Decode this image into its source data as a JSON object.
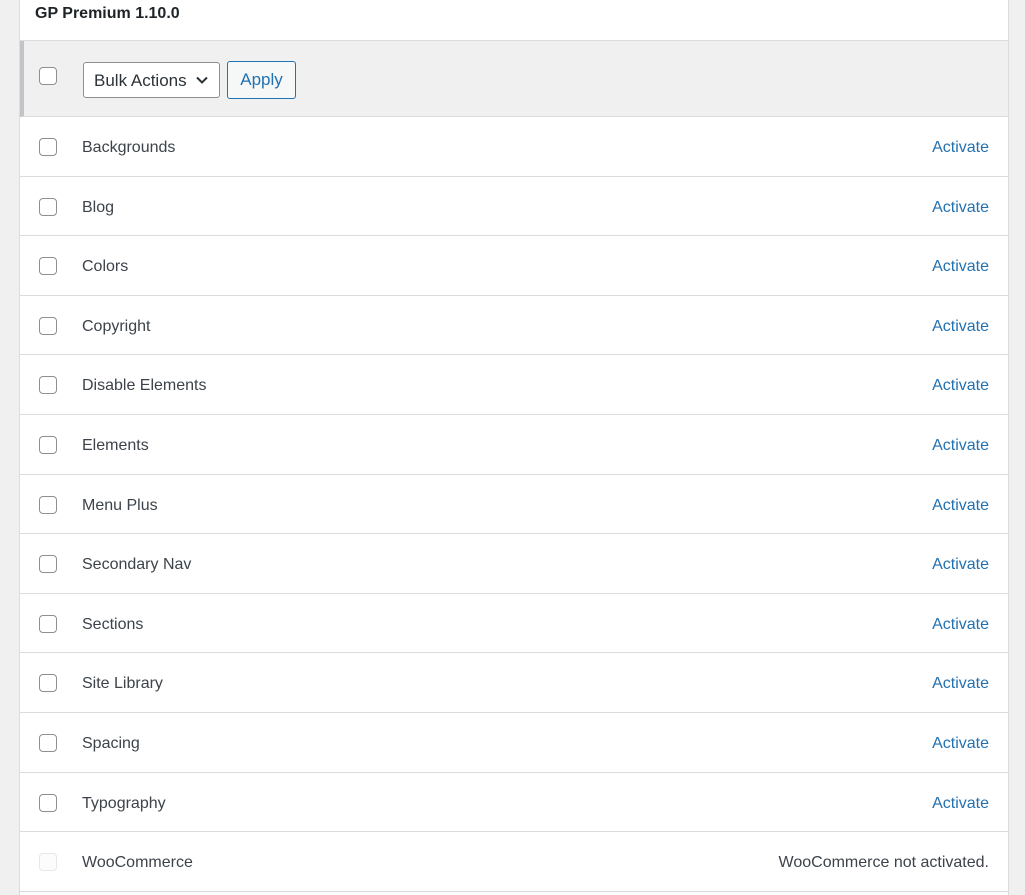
{
  "header": {
    "title": "GP Premium 1.10.0"
  },
  "bulk": {
    "select_label": "Bulk Actions",
    "apply_label": "Apply"
  },
  "modules": [
    {
      "name": "Backgrounds",
      "action": "Activate"
    },
    {
      "name": "Blog",
      "action": "Activate"
    },
    {
      "name": "Colors",
      "action": "Activate"
    },
    {
      "name": "Copyright",
      "action": "Activate"
    },
    {
      "name": "Disable Elements",
      "action": "Activate"
    },
    {
      "name": "Elements",
      "action": "Activate"
    },
    {
      "name": "Menu Plus",
      "action": "Activate"
    },
    {
      "name": "Secondary Nav",
      "action": "Activate"
    },
    {
      "name": "Sections",
      "action": "Activate"
    },
    {
      "name": "Site Library",
      "action": "Activate"
    },
    {
      "name": "Spacing",
      "action": "Activate"
    },
    {
      "name": "Typography",
      "action": "Activate"
    },
    {
      "name": "WooCommerce",
      "action": "WooCommerce not activated."
    }
  ],
  "colors": {
    "link": "#2271b1",
    "text": "#3c434a",
    "border": "#dcdcde"
  }
}
